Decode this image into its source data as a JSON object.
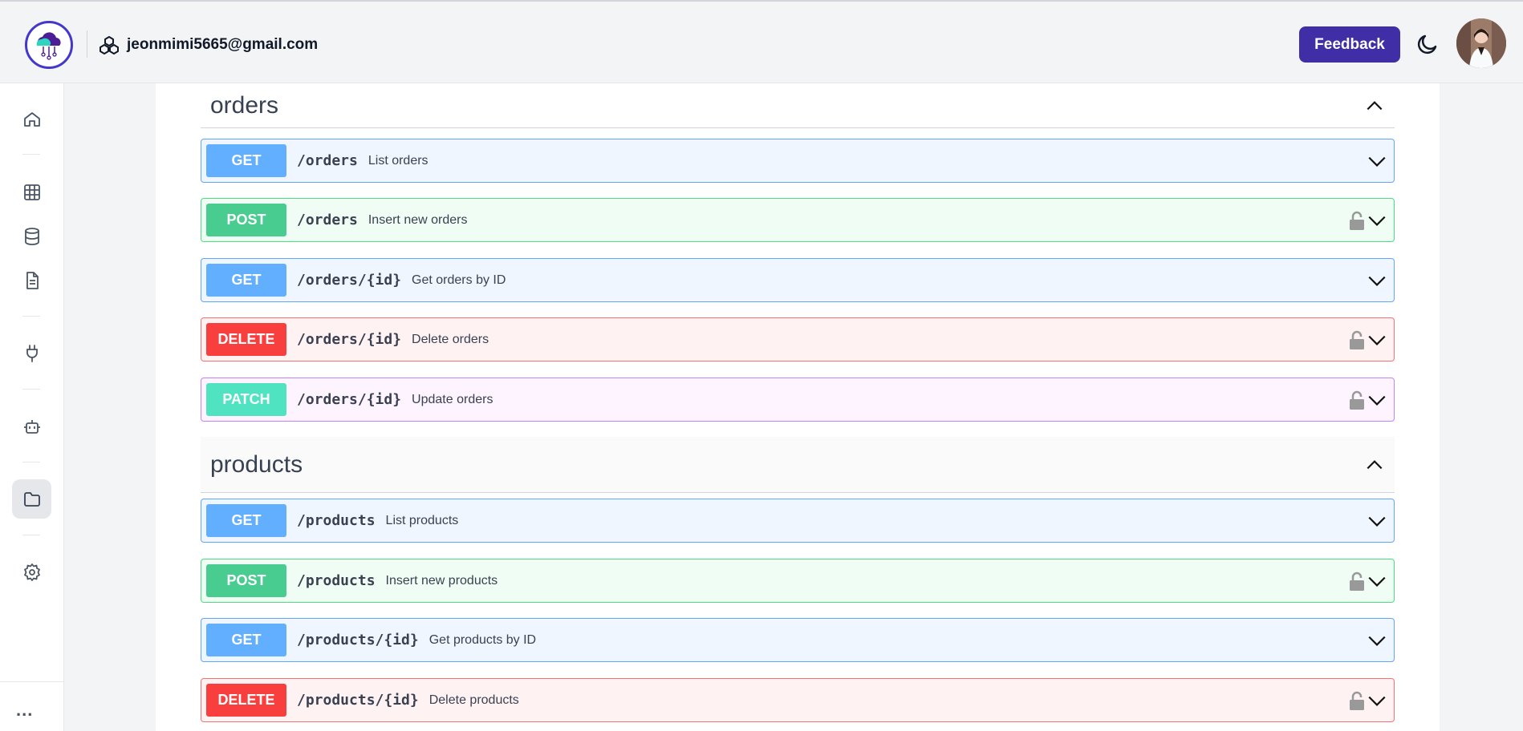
{
  "header": {
    "email": "jeonmimi5665@gmail.com",
    "feedback_label": "Feedback"
  },
  "colors": {
    "brand": "#3f2ea6",
    "get": "#61affe",
    "post": "#49cc90",
    "delete": "#f93e3e",
    "patch": "#50e3c2"
  },
  "sidebar": {
    "items": [
      {
        "icon": "home-icon"
      },
      {
        "icon": "grid-icon"
      },
      {
        "icon": "database-icon"
      },
      {
        "icon": "document-icon"
      },
      {
        "icon": "plug-icon"
      },
      {
        "icon": "robot-icon"
      },
      {
        "icon": "folder-icon",
        "active": true
      },
      {
        "icon": "gear-icon"
      }
    ],
    "more_label": "..."
  },
  "sections": [
    {
      "title": "orders",
      "operations": [
        {
          "method": "GET",
          "path": "/orders",
          "summary": "List orders",
          "locked": false
        },
        {
          "method": "POST",
          "path": "/orders",
          "summary": "Insert new orders",
          "locked": true
        },
        {
          "method": "GET",
          "path": "/orders/{id}",
          "summary": "Get orders by ID",
          "locked": false
        },
        {
          "method": "DELETE",
          "path": "/orders/{id}",
          "summary": "Delete orders",
          "locked": true
        },
        {
          "method": "PATCH",
          "path": "/orders/{id}",
          "summary": "Update orders",
          "locked": true
        }
      ]
    },
    {
      "title": "products",
      "operations": [
        {
          "method": "GET",
          "path": "/products",
          "summary": "List products",
          "locked": false
        },
        {
          "method": "POST",
          "path": "/products",
          "summary": "Insert new products",
          "locked": true
        },
        {
          "method": "GET",
          "path": "/products/{id}",
          "summary": "Get products by ID",
          "locked": false
        },
        {
          "method": "DELETE",
          "path": "/products/{id}",
          "summary": "Delete products",
          "locked": true
        }
      ]
    }
  ]
}
